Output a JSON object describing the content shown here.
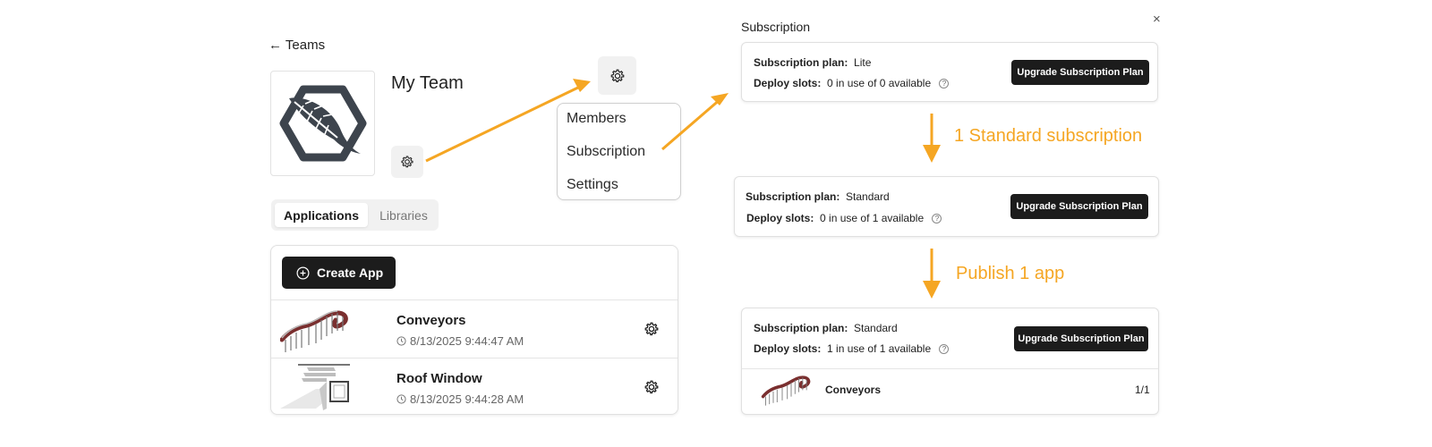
{
  "nav": {
    "back_label": "← Teams"
  },
  "team": {
    "name": "My Team"
  },
  "menu": {
    "items": [
      "Members",
      "Subscription",
      "Settings"
    ]
  },
  "tabs": [
    {
      "label": "Applications",
      "active": true
    },
    {
      "label": "Libraries",
      "active": false
    }
  ],
  "apps_panel": {
    "create_label": "Create App",
    "apps": [
      {
        "name": "Conveyors",
        "date": "8/13/2025 9:44:47 AM"
      },
      {
        "name": "Roof Window",
        "date": "8/13/2025 9:44:28 AM"
      }
    ]
  },
  "subscription_panel": {
    "title": "Subscription",
    "close_label": "×",
    "plan_label": "Subscription plan:",
    "slots_label": "Deploy slots:",
    "upgrade_label": "Upgrade Subscription Plan",
    "cards": [
      {
        "plan": "Lite",
        "slots": "0 in use of 0 available"
      },
      {
        "plan": "Standard",
        "slots": "0 in use of 1 available"
      },
      {
        "plan": "Standard",
        "slots": "1 in use of 1 available",
        "deployed_app": {
          "name": "Conveyors",
          "usage": "1/1"
        }
      }
    ]
  },
  "flow": {
    "step1_label": "1 Standard subscription",
    "step2_label": "Publish 1 app",
    "accent_color": "#f5a623"
  }
}
